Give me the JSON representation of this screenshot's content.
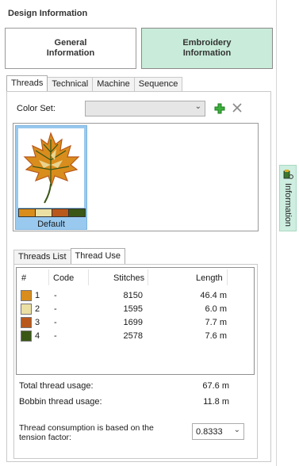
{
  "panel": {
    "title": "Design Information"
  },
  "buttons": {
    "general": "General\nInformation",
    "embroidery": "Embroidery\nInformation"
  },
  "tabs": [
    "Threads",
    "Technical",
    "Machine",
    "Sequence"
  ],
  "color_set": {
    "label": "Color Set:",
    "value": ""
  },
  "swatch": {
    "name": "Default",
    "colors": [
      "#d98d1c",
      "#ebe0a3",
      "#b8581c",
      "#3a5716"
    ]
  },
  "subtabs": [
    "Threads List",
    "Thread Use"
  ],
  "thread_table": {
    "headers": [
      "#",
      "Code",
      "Stitches",
      "Length"
    ],
    "rows": [
      {
        "num": "1",
        "code": "-",
        "stitches": "8150",
        "length": "46.4 m",
        "color": "#d98d1c"
      },
      {
        "num": "2",
        "code": "-",
        "stitches": "1595",
        "length": "6.0 m",
        "color": "#ebe0a3"
      },
      {
        "num": "3",
        "code": "-",
        "stitches": "1699",
        "length": "7.7 m",
        "color": "#b8581c"
      },
      {
        "num": "4",
        "code": "-",
        "stitches": "2578",
        "length": "7.6 m",
        "color": "#3a5716"
      }
    ]
  },
  "usage": {
    "total_label": "Total thread usage:",
    "total_value": "67.6 m",
    "bobbin_label": "Bobbin thread usage:",
    "bobbin_value": "11.8 m"
  },
  "tension": {
    "label": "Thread consumption is based on the tension factor:",
    "value": "0.8333"
  },
  "side_tab": {
    "label": "Information"
  },
  "colors": {
    "accent_green": "#c8ecd9",
    "selection_blue": "#99c9ef"
  }
}
